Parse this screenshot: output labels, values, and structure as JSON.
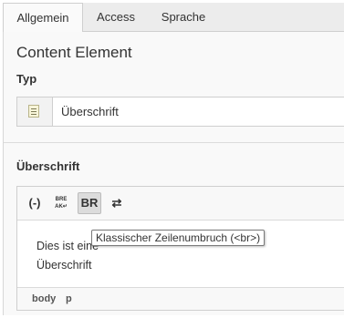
{
  "tabs": [
    {
      "label": "Allgemein",
      "active": true
    },
    {
      "label": "Access",
      "active": false
    },
    {
      "label": "Sprache",
      "active": false
    }
  ],
  "section_title": "Content Element",
  "type_field": {
    "label": "Typ",
    "value": "Überschrift",
    "icon": "content-element-header-icon"
  },
  "editor": {
    "label": "Überschrift",
    "toolbar": [
      {
        "name": "remove-format-icon",
        "glyph": "(-)"
      },
      {
        "name": "break-return-icon",
        "glyph": "BRE\nAK↵"
      },
      {
        "name": "linebreak-br-icon",
        "glyph": "BR",
        "active": true
      },
      {
        "name": "clean-paste-icon",
        "glyph": "⇄"
      }
    ],
    "content_lines": [
      "Dies ist eine",
      "Überschrift"
    ],
    "tooltip": "Klassischer Zeilenumbruch (<br>)",
    "path": [
      "body",
      "p"
    ]
  }
}
